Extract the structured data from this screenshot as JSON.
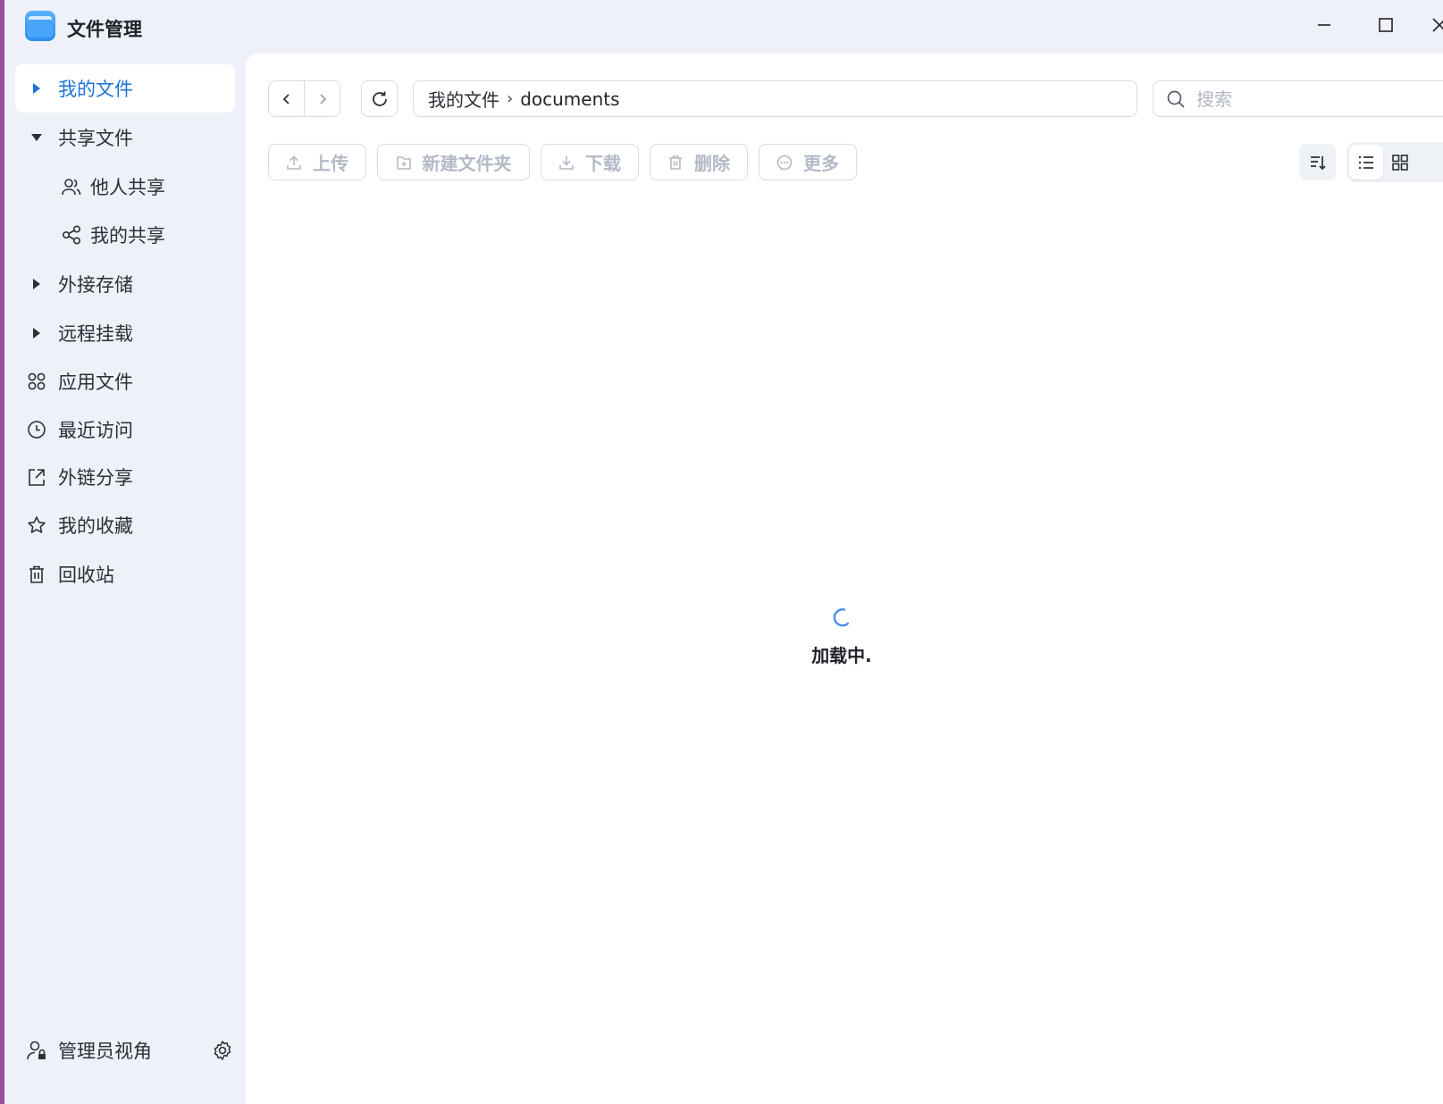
{
  "app": {
    "title": "文件管理"
  },
  "sidebar": {
    "items": [
      {
        "label": "我的文件"
      },
      {
        "label": "共享文件"
      },
      {
        "label": "他人共享"
      },
      {
        "label": "我的共享"
      },
      {
        "label": "外接存储"
      },
      {
        "label": "远程挂载"
      },
      {
        "label": "应用文件"
      },
      {
        "label": "最近访问"
      },
      {
        "label": "外链分享"
      },
      {
        "label": "我的收藏"
      },
      {
        "label": "回收站"
      }
    ],
    "footer": {
      "label": "管理员视角"
    }
  },
  "pathbar": {
    "root": "我的文件",
    "current": "documents"
  },
  "search": {
    "placeholder": "搜索"
  },
  "toolbar": {
    "upload": "上传",
    "new_folder": "新建文件夹",
    "download": "下载",
    "delete": "删除",
    "more": "更多"
  },
  "status": {
    "loading_text": "加载中."
  },
  "colors": {
    "accent": "#1e73d6",
    "sidebar_bg": "#eef1f7",
    "disabled_text": "#b3bac6"
  }
}
